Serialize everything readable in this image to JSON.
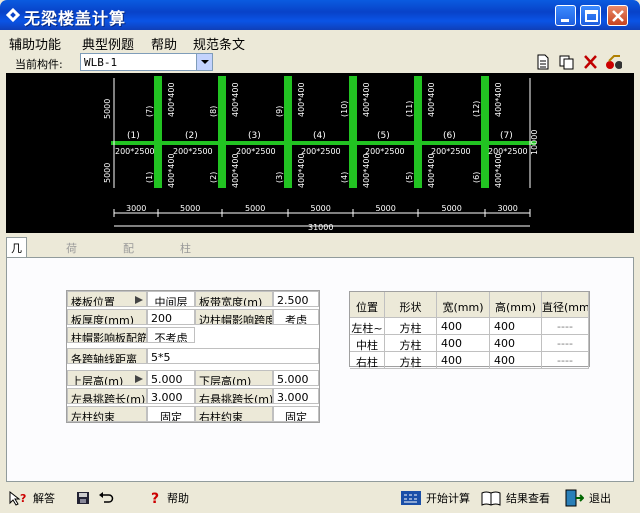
{
  "window": {
    "title": "无梁楼盖计算"
  },
  "menu": [
    "辅助功能",
    "典型例题",
    "帮助",
    "规范条文"
  ],
  "component": {
    "label": "当前构件:",
    "value": "WLB-1"
  },
  "drawing": {
    "bay_numbers": [
      "(1)",
      "(2)",
      "(3)",
      "(4)",
      "(5)",
      "(6)",
      "(7)"
    ],
    "strip_label": "200*2500",
    "col_label": "400*400",
    "top_col_nums": [
      "(7)",
      "(8)",
      "(9)",
      "(10)",
      "(11)",
      "(12)"
    ],
    "bot_col_nums": [
      "(1)",
      "(2)",
      "(3)",
      "(4)",
      "(5)",
      "(6)"
    ],
    "spans": [
      "3000",
      "5000",
      "5000",
      "5000",
      "5000",
      "5000",
      "3000"
    ],
    "total": "31000",
    "left_dims": [
      "5000",
      "5000"
    ],
    "right_dim": "10000"
  },
  "tabs": [
    "几何信息",
    "荷载信息",
    "配筋信息",
    "柱帽信息"
  ],
  "form": {
    "slab_pos_label": "楼板位置",
    "slab_pos_value": "中间层",
    "strip_width_label": "板带宽度(m)",
    "strip_width_value": "2.500",
    "thickness_label": "板厚度(mm)",
    "thickness_value": "200",
    "edge_width_label": "边柱帽影响跨度",
    "edge_width_value": "考虑",
    "cap_influence_label": "柱帽影响板配筋",
    "cap_influence_value": "不考虑",
    "spans_label": "各跨轴线距离",
    "spans_value": "5*5",
    "upper_h_label": "上层高(m)",
    "upper_h_value": "5.000",
    "lower_h_label": "下层高(m)",
    "lower_h_value": "5.000",
    "left_cant_label": "左悬挑跨长(m)",
    "left_cant_value": "3.000",
    "right_cant_label": "右悬挑跨长(m)",
    "right_cant_value": "3.000",
    "left_fix_label": "左柱约束",
    "left_fix_value": "固定",
    "right_fix_label": "右柱约束",
    "right_fix_value": "固定"
  },
  "section_table": {
    "headers": [
      "位置",
      "形状",
      "宽(mm)",
      "高(mm)",
      "直径(mm)"
    ],
    "rows": [
      [
        "左柱~",
        "方柱",
        "400",
        "400",
        "----"
      ],
      [
        "中柱",
        "方柱",
        "400",
        "400",
        "----"
      ],
      [
        "右柱",
        "方柱",
        "400",
        "400",
        "----"
      ]
    ]
  },
  "bottom": {
    "help_q": "解答",
    "help": "帮助",
    "calc": "开始计算",
    "view": "结果查看",
    "exit": "退出"
  }
}
